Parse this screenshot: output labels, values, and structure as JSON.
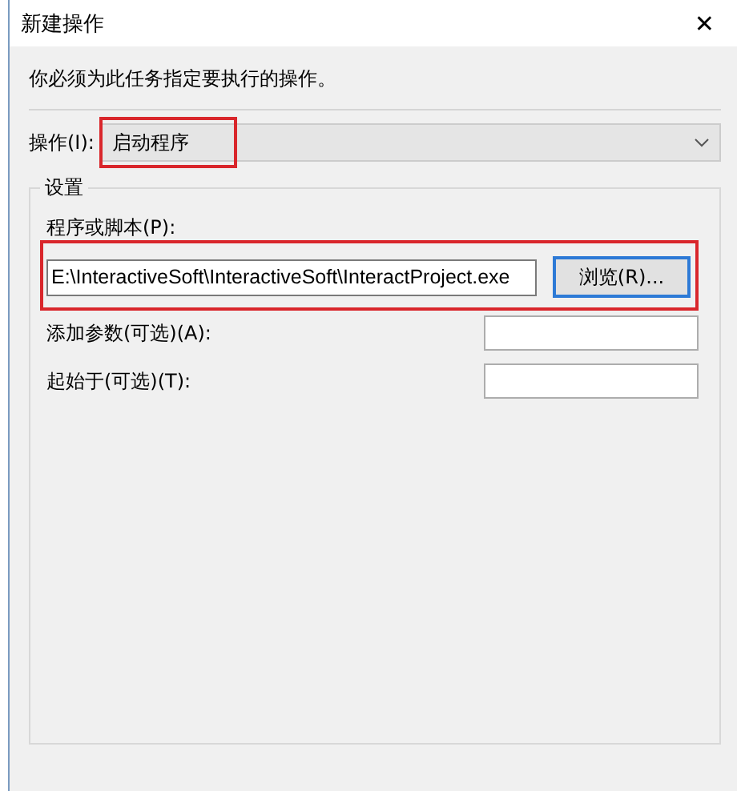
{
  "window": {
    "title": "新建操作",
    "close_glyph": "✕"
  },
  "instruction": "你必须为此任务指定要执行的操作。",
  "action": {
    "label": "操作(I):",
    "value": "启动程序",
    "highlighted": true
  },
  "settings": {
    "title": "设置",
    "program": {
      "label": "程序或脚本(P):",
      "value": "E:\\InteractiveSoft\\InteractiveSoft\\InteractProject.exe",
      "highlighted": true
    },
    "browse_button": "浏览(R)...",
    "fields": [
      {
        "label": "添加参数(可选)(A):"
      },
      {
        "label": "起始于(可选)(T):"
      }
    ]
  }
}
